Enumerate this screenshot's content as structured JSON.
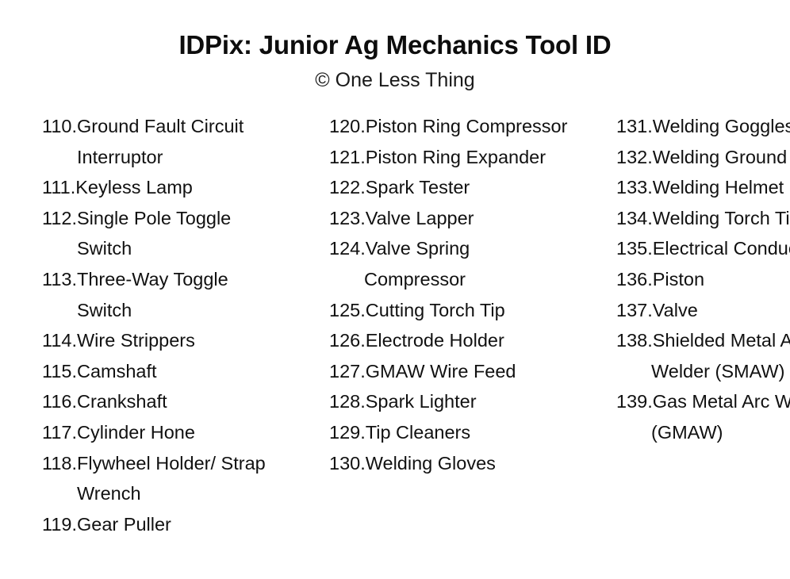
{
  "header": {
    "title": "IDPix: Junior Ag Mechanics Tool ID",
    "subtitle": "© One Less Thing"
  },
  "columns": [
    {
      "name": "column-1",
      "entries": [
        {
          "number": "110.",
          "label": "Ground Fault Circuit Interruptor"
        },
        {
          "number": "111.",
          "label": "Keyless Lamp"
        },
        {
          "number": "112.",
          "label": "Single Pole Toggle Switch"
        },
        {
          "number": "113.",
          "label": "Three-Way Toggle Switch"
        },
        {
          "number": "114.",
          "label": "Wire Strippers"
        },
        {
          "number": "115.",
          "label": "Camshaft"
        },
        {
          "number": "116.",
          "label": "Crankshaft"
        },
        {
          "number": "117.",
          "label": "Cylinder Hone"
        },
        {
          "number": "118.",
          "label": "Flywheel Holder/ Strap Wrench"
        },
        {
          "number": "119.",
          "label": "Gear Puller"
        }
      ]
    },
    {
      "name": "column-2",
      "entries": [
        {
          "number": "120.",
          "label": "Piston Ring Compressor"
        },
        {
          "number": "121.",
          "label": "Piston Ring Expander"
        },
        {
          "number": "122.",
          "label": "Spark Tester"
        },
        {
          "number": "123.",
          "label": "Valve Lapper"
        },
        {
          "number": "124.",
          "label": "Valve Spring Compressor"
        },
        {
          "number": "125.",
          "label": "Cutting Torch Tip"
        },
        {
          "number": "126.",
          "label": "Electrode Holder"
        },
        {
          "number": "127.",
          "label": "GMAW Wire Feed"
        },
        {
          "number": "128.",
          "label": "Spark Lighter"
        },
        {
          "number": "129.",
          "label": "Tip Cleaners"
        },
        {
          "number": "130.",
          "label": "Welding Gloves"
        }
      ]
    },
    {
      "name": "column-3",
      "entries": [
        {
          "number": "131.",
          "label": "Welding Goggles"
        },
        {
          "number": "132.",
          "label": "Welding Ground Clamp"
        },
        {
          "number": "133.",
          "label": "Welding Helmet"
        },
        {
          "number": "134.",
          "label": "Welding Torch Tip"
        },
        {
          "number": "135.",
          "label": "Electrical Conductor"
        },
        {
          "number": "136.",
          "label": "Piston"
        },
        {
          "number": "137.",
          "label": "Valve"
        },
        {
          "number": "138.",
          "label": "Shielded Metal Arc Welder (SMAW)"
        },
        {
          "number": "139.",
          "label": "Gas Metal Arc Welder (GMAW)"
        }
      ]
    }
  ]
}
